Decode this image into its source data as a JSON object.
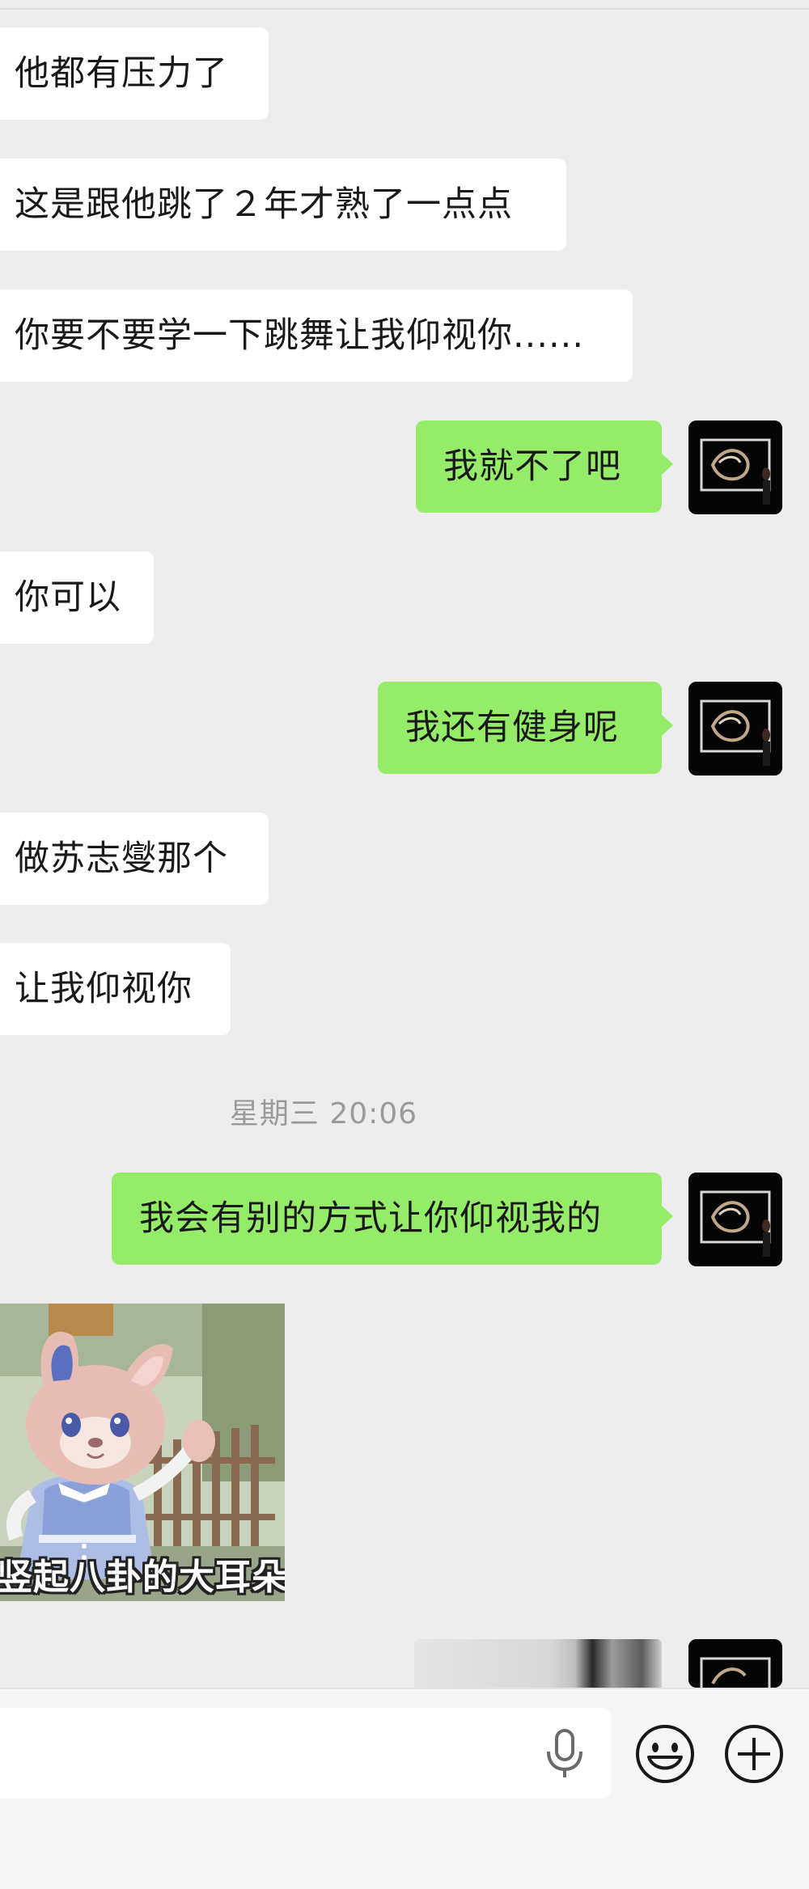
{
  "messages": [
    {
      "direction": "in",
      "text": "他都有压力了"
    },
    {
      "direction": "in",
      "text": "这是跟他跳了２年才熟了一点点"
    },
    {
      "direction": "in",
      "text": "你要不要学一下跳舞让我仰视你......"
    },
    {
      "direction": "out",
      "text": "我就不了吧"
    },
    {
      "direction": "in",
      "text": "你可以"
    },
    {
      "direction": "out",
      "text": "我还有健身呢"
    },
    {
      "direction": "in",
      "text": "做苏志燮那个"
    },
    {
      "direction": "in",
      "text": "让我仰视你"
    },
    {
      "direction": "out",
      "text": "我会有别的方式让你仰视我的"
    }
  ],
  "timestamp": "星期三 20:06",
  "sticker": {
    "caption": "竖起八卦的大耳朵"
  },
  "input_bar": {
    "placeholder": "",
    "icons": [
      "microphone-icon",
      "emoji-icon",
      "plus-icon"
    ]
  },
  "colors": {
    "background": "#ededed",
    "incoming_bubble": "#ffffff",
    "outgoing_bubble": "#95ec69",
    "timestamp_text": "#9a9a9a"
  }
}
